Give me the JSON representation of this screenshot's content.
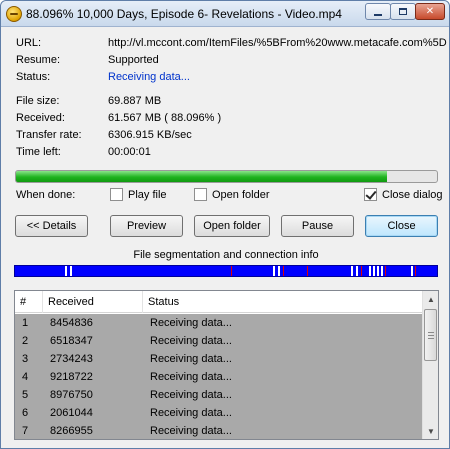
{
  "window": {
    "title": "88.096% 10,000 Days, Episode 6- Revelations - Video.mp4",
    "icons": {
      "app": "download-app-icon",
      "minimize": "minimize-icon",
      "maximize": "maximize-icon",
      "close": "close-icon"
    }
  },
  "info": {
    "url_label": "URL:",
    "url_value": "http://vl.mccont.com/ItemFiles/%5BFrom%20www.metacafe.com%5D",
    "resume_label": "Resume:",
    "resume_value": "Supported",
    "status_label": "Status:",
    "status_value": "Receiving data...",
    "filesize_label": "File size:",
    "filesize_value": "69.887 MB",
    "received_label": "Received:",
    "received_value": "61.567 MB ( 88.096% )",
    "rate_label": "Transfer rate:",
    "rate_value": "6306.915 KB/sec",
    "timeleft_label": "Time left:",
    "timeleft_value": "00:00:01"
  },
  "progress": {
    "percent": 88.096,
    "color": "#1fb31f"
  },
  "when_done": {
    "label": "When done:",
    "options": [
      {
        "label": "Play file",
        "checked": false
      },
      {
        "label": "Open folder",
        "checked": false
      },
      {
        "label": "Close dialog",
        "checked": true
      }
    ]
  },
  "buttons": {
    "details": "<< Details",
    "preview": "Preview",
    "open_folder": "Open folder",
    "pause": "Pause",
    "close": "Close"
  },
  "segmentation": {
    "title": "File segmentation and connection info",
    "bar_color": "#0000ff"
  },
  "connections": {
    "columns": [
      "#",
      "Received",
      "Status"
    ],
    "rows": [
      {
        "n": "1",
        "received": "8454836",
        "status": "Receiving data..."
      },
      {
        "n": "2",
        "received": "6518347",
        "status": "Receiving data..."
      },
      {
        "n": "3",
        "received": "2734243",
        "status": "Receiving data..."
      },
      {
        "n": "4",
        "received": "9218722",
        "status": "Receiving data..."
      },
      {
        "n": "5",
        "received": "8976750",
        "status": "Receiving data..."
      },
      {
        "n": "6",
        "received": "2061044",
        "status": "Receiving data..."
      },
      {
        "n": "7",
        "received": "8266955",
        "status": "Receiving data..."
      }
    ],
    "scroll_icons": {
      "up": "scroll-up-icon",
      "down": "scroll-down-icon"
    }
  }
}
